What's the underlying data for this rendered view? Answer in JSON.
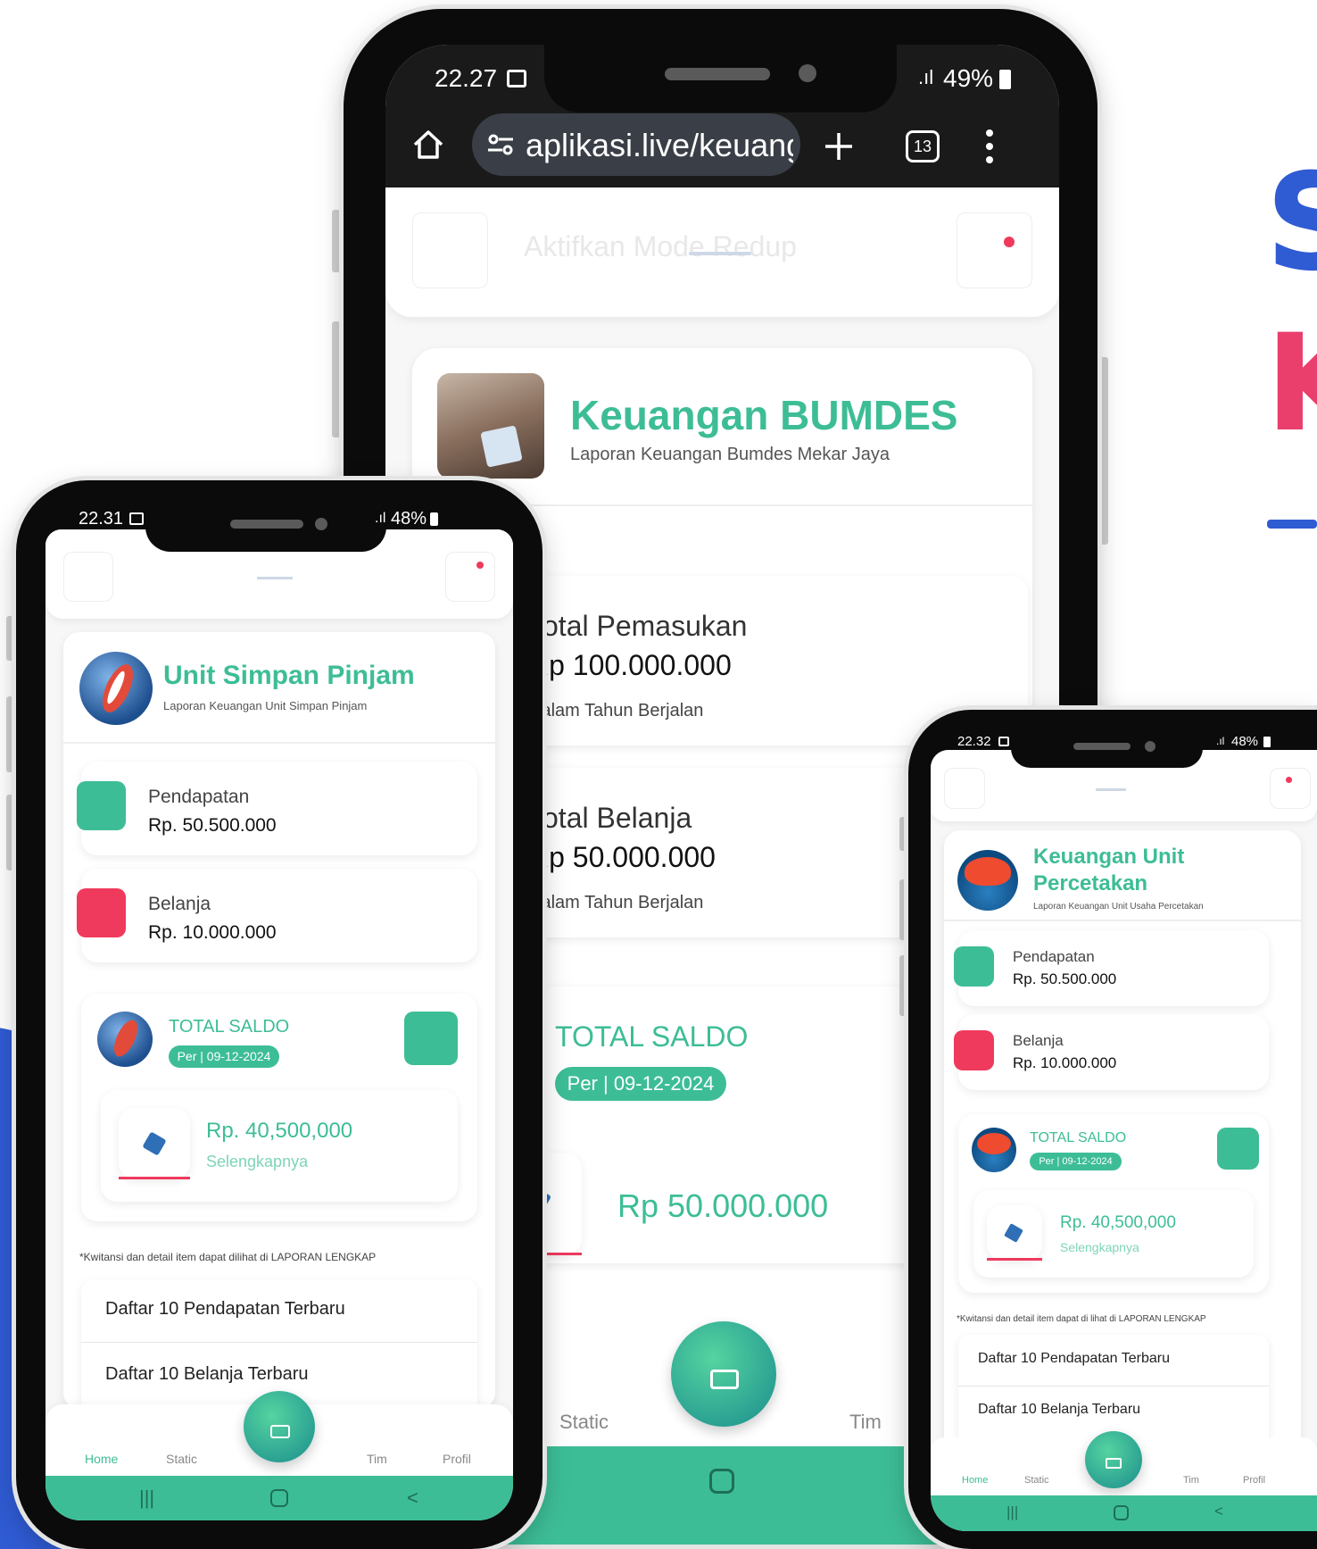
{
  "colors": {
    "accent": "#3dbd96",
    "danger": "#ef3a5d",
    "brand_blue": "#2f5bd3",
    "brand_pink": "#ea3e6c"
  },
  "side": {
    "letter1": "S",
    "letter2": "K"
  },
  "center": {
    "status_time": "22.27",
    "status_battery": "49%",
    "url": "aplikasi.live/keuang",
    "tab_count": "13",
    "mode_text": "Aktifkan Mode Redup",
    "title": "Keuangan BUMDES",
    "subtitle": "Laporan Keuangan Bumdes Mekar Jaya",
    "income_label": "Total Pemasukan",
    "income_value": "Rp 100.000.000",
    "income_note": "Dalam Tahun Berjalan",
    "expense_label": "Total Belanja",
    "expense_value": "Rp 50.000.000",
    "expense_note": "Dalam Tahun Berjalan",
    "saldo_label": "TOTAL SALDO",
    "saldo_date": "Per | 09-12-2024",
    "saldo_value": "Rp 50.000.000",
    "nav": {
      "static": "Static",
      "tim": "Tim"
    }
  },
  "left": {
    "status_time": "22.31",
    "status_battery": "48%",
    "title": "Unit Simpan Pinjam",
    "subtitle": "Laporan Keuangan Unit Simpan Pinjam",
    "income_label": "Pendapatan",
    "income_value": "Rp. 50.500.000",
    "expense_label": "Belanja",
    "expense_value": "Rp. 10.000.000",
    "saldo_label": "TOTAL SALDO",
    "saldo_date": "Per | 09-12-2024",
    "saldo_value": "Rp. 40,500,000",
    "more": "Selengkapnya",
    "note": "*Kwitansi dan detail item dapat dilihat di LAPORAN LENGKAP",
    "list1": "Daftar 10 Pendapatan Terbaru",
    "list2": "Daftar 10 Belanja Terbaru",
    "nav": {
      "home": "Home",
      "static": "Static",
      "tim": "Tim",
      "profil": "Profil"
    }
  },
  "right": {
    "status_time": "22.32",
    "status_battery": "48%",
    "title1": "Keuangan Unit",
    "title2": "Percetakan",
    "subtitle": "Laporan Keuangan Unit Usaha Percetakan",
    "income_label": "Pendapatan",
    "income_value": "Rp. 50.500.000",
    "expense_label": "Belanja",
    "expense_value": "Rp. 10.000.000",
    "saldo_label": "TOTAL SALDO",
    "saldo_date": "Per | 09-12-2024",
    "saldo_value": "Rp. 40,500,000",
    "more": "Selengkapnya",
    "note": "*Kwitansi dan detail item dapat di lihat di LAPORAN LENGKAP",
    "list1": "Daftar 10 Pendapatan Terbaru",
    "list2": "Daftar 10 Belanja Terbaru",
    "nav": {
      "home": "Home",
      "static": "Static",
      "tim": "Tim",
      "profil": "Profil"
    }
  }
}
